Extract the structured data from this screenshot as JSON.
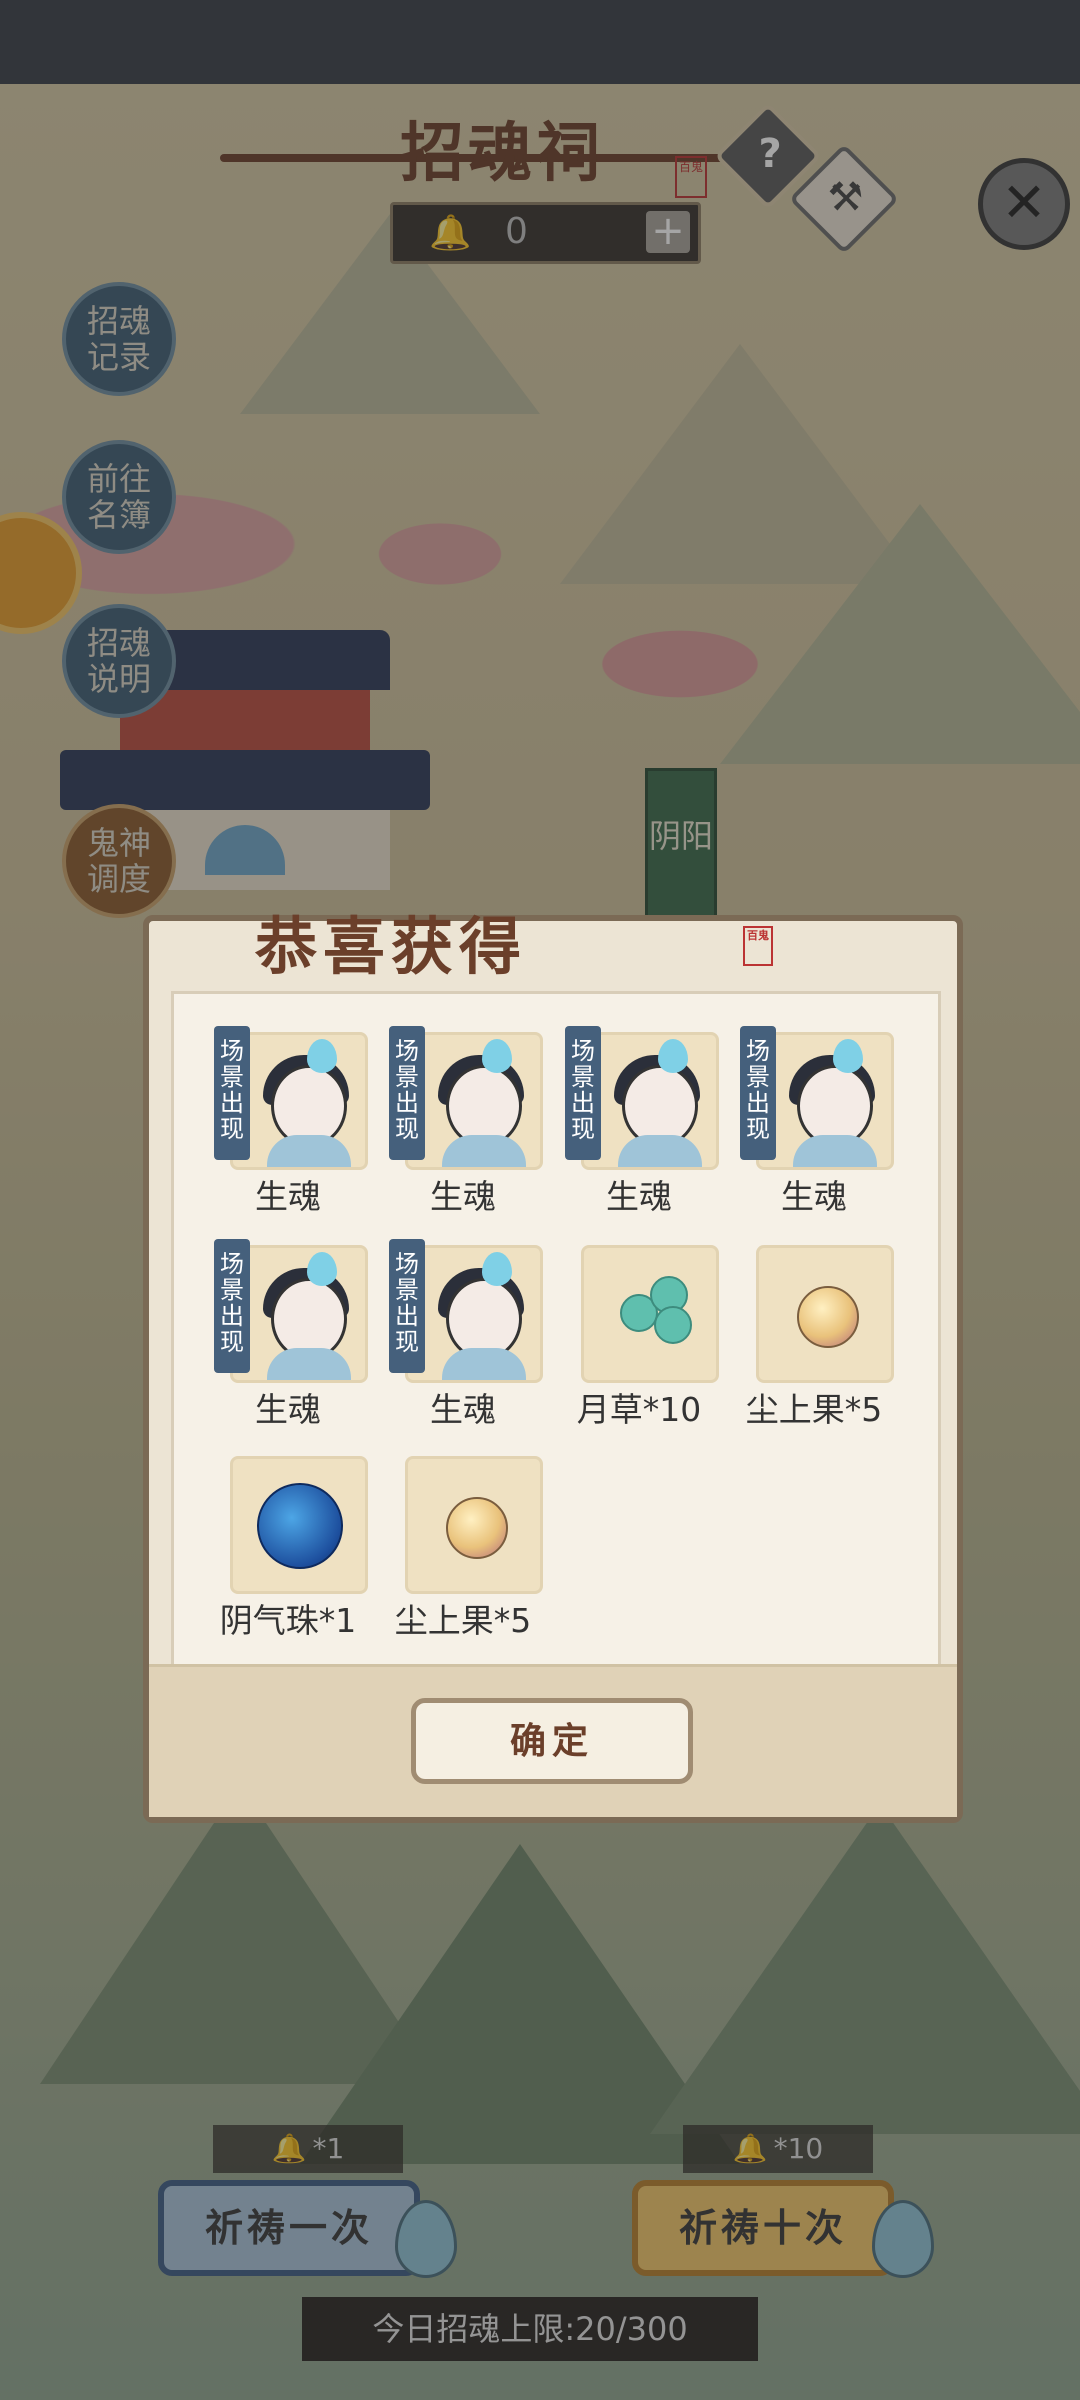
{
  "header": {
    "title": "招魂祠",
    "title_seal": "百鬼",
    "help_icon": "question-icon",
    "hammer_icon": "hammer-icon",
    "close_icon": "close-icon",
    "currency": {
      "icon": "bell-icon",
      "value": "0",
      "plus_label": "+"
    }
  },
  "side_menu": [
    {
      "label": "招魂\n记录"
    },
    {
      "label": "前往\n名簿"
    },
    {
      "label": "招魂\n说明"
    },
    {
      "label": "鬼神\n调度"
    }
  ],
  "map_banner": "阴阳",
  "dialog": {
    "title": "恭喜获得",
    "title_seal": "百鬼",
    "confirm_label": "确定",
    "items": [
      {
        "label": "生魂",
        "tag": "场景出现",
        "icon": "soul-male-icon"
      },
      {
        "label": "生魂",
        "tag": "场景出现",
        "icon": "soul-elder-icon"
      },
      {
        "label": "生魂",
        "tag": "场景出现",
        "icon": "soul-male-icon"
      },
      {
        "label": "生魂",
        "tag": "场景出现",
        "icon": "soul-elder-icon"
      },
      {
        "label": "生魂",
        "tag": "场景出现",
        "icon": "soul-female-icon"
      },
      {
        "label": "生魂",
        "tag": "场景出现",
        "icon": "soul-female-icon"
      },
      {
        "label": "月草*10",
        "tag": "",
        "icon": "moon-grass-icon"
      },
      {
        "label": "尘上果*5",
        "tag": "",
        "icon": "dust-fruit-icon"
      },
      {
        "label": "阴气珠*1",
        "tag": "",
        "icon": "yin-orb-icon"
      },
      {
        "label": "尘上果*5",
        "tag": "",
        "icon": "dust-fruit-icon"
      }
    ]
  },
  "bottom": {
    "pray_once": {
      "cost": "*1",
      "label": "祈祷一次"
    },
    "pray_ten": {
      "cost": "*10",
      "label": "祈祷十次"
    },
    "daily_limit": "今日招魂上限:20/300"
  },
  "colors": {
    "title_brown": "#6b3f2a",
    "tag_blue": "#45607c",
    "pray_blue": "#a9c3da",
    "pray_gold": "#f2c76a"
  }
}
